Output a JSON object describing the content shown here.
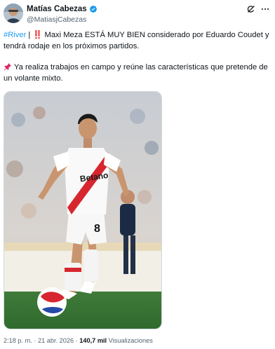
{
  "author": {
    "display_name": "Matías Cabezas",
    "handle": "@MatiasjCabezas",
    "verified": true
  },
  "header_icons": {
    "grok": "grok-icon",
    "more": "more-icon"
  },
  "tweet": {
    "hashtag": "#River",
    "separator": " | ",
    "alert_emoji": "‼️",
    "line1_body": " Maxi Meza ESTÁ MUY BIEN considerado por Eduardo Coudet y tendrá rodaje en los próximos partidos.",
    "pin_emoji": "pushpin-icon",
    "line2_body": "Ya realiza trabajos en campo y reúne las características que pretende de un volante mixto."
  },
  "media": {
    "jersey_sponsor": "Betano",
    "jersey_number": "8",
    "description_icon": "soccer-photo"
  },
  "meta": {
    "time": "2:18 p. m.",
    "dot1": " · ",
    "date": "21 abr. 2026",
    "dot2": " · ",
    "views_count": "140,7 mil",
    "views_label": " Visualizaciones"
  },
  "colors": {
    "link": "#1d9bf0",
    "verified": "#1d9bf0",
    "text": "#0f1419",
    "secondary": "#536471",
    "river_red": "#d7262f"
  }
}
